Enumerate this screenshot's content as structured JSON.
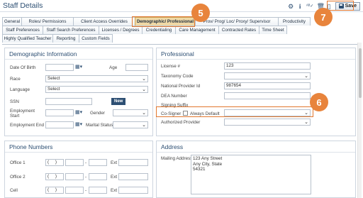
{
  "window": {
    "title": "Staff Details",
    "save_label": "Save",
    "icons": [
      "gear-icon",
      "info-icon",
      "spellcheck-icon",
      "trash-icon",
      "document-icon",
      "save-icon"
    ]
  },
  "tabs": {
    "row1": [
      "General",
      "Roles/ Permissions",
      "Client Access Overrides",
      "Demographic/ Professional",
      "Prov/ Prog/ Loc/ Proxy/ Supervisor",
      "Productivity"
    ],
    "row2": [
      "Staff Preferences",
      "Staff Search Preferences",
      "Licenses / Degrees",
      "Credentialing",
      "Care Management",
      "Contracted Rates",
      "Time Sheet"
    ],
    "row3": [
      "Highly Qualified Teacher",
      "Reporting",
      "Custom Fields"
    ],
    "active": "Demographic/ Professional"
  },
  "demographic": {
    "title": "Demographic Information",
    "dob_label": "Date Of Birth",
    "age_label": "Age",
    "race_label": "Race",
    "race_value": "Select",
    "language_label": "Language",
    "language_value": "Select",
    "ssn_label": "SSN",
    "new_label": "New",
    "employment_start_label_1": "Employment",
    "employment_start_label_2": "Start",
    "gender_label": "Gender",
    "employment_end_label": "Employment End",
    "marital_status_label": "Marital Status"
  },
  "professional": {
    "title": "Professional",
    "license_label": "License #",
    "license_value": "123",
    "taxonomy_label": "Taxonomy Code",
    "npi_label": "National Provider Id",
    "npi_value": "987654",
    "dea_label": "DEA Number",
    "signing_suffix_label": "Signing Suffix",
    "cosigner_label": "Co-Signer",
    "always_default_label": "Always Default",
    "authorized_provider_label": "Authorized Provider"
  },
  "phone": {
    "title": "Phone Numbers",
    "office1_label": "Office 1",
    "office2_label": "Office 2",
    "cell_label": "Cell",
    "ext_label": "Ext"
  },
  "address": {
    "title": "Address",
    "mailing_label": "Mailing Address",
    "line1": "123 Any Street",
    "line2": "Any City, State",
    "line3": "54321"
  },
  "callouts": {
    "five": "5",
    "six": "6",
    "seven": "7",
    "color": "#e8843c"
  }
}
